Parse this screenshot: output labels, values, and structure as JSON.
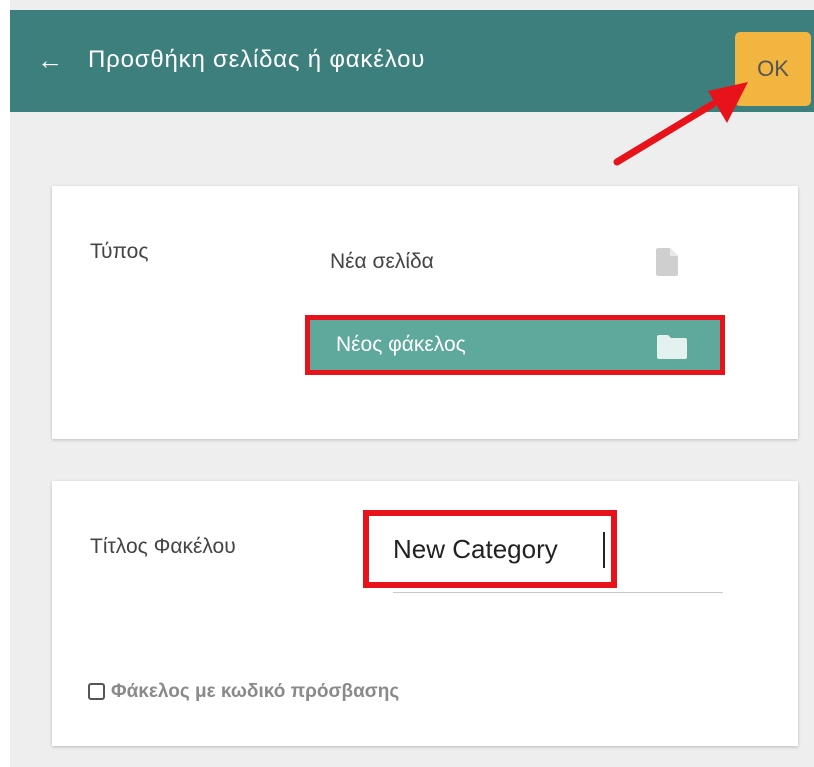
{
  "header": {
    "back_icon": "arrow-left-icon",
    "title": "Προσθήκη σελίδας ή φακέλου",
    "ok_label": "OK"
  },
  "type_card": {
    "label": "Τύπος",
    "options": [
      {
        "label": "Νέα σελίδα",
        "icon": "page-icon",
        "selected": false
      },
      {
        "label": "Νέος φάκελος",
        "icon": "folder-icon",
        "selected": true
      }
    ]
  },
  "title_card": {
    "label": "Τίτλος Φακέλου",
    "input_value": "New Category",
    "password_label": "Φάκελος με κωδικό πρόσβασης",
    "password_checked": false
  },
  "colors": {
    "header_bg": "#3d7f7d",
    "ok_button": "#f2b540",
    "selected_option": "#5ea89c",
    "highlight": "#e8121b",
    "background": "#eeeeee"
  },
  "annotations": {
    "arrow": "red-arrow-pointing-to-ok"
  }
}
